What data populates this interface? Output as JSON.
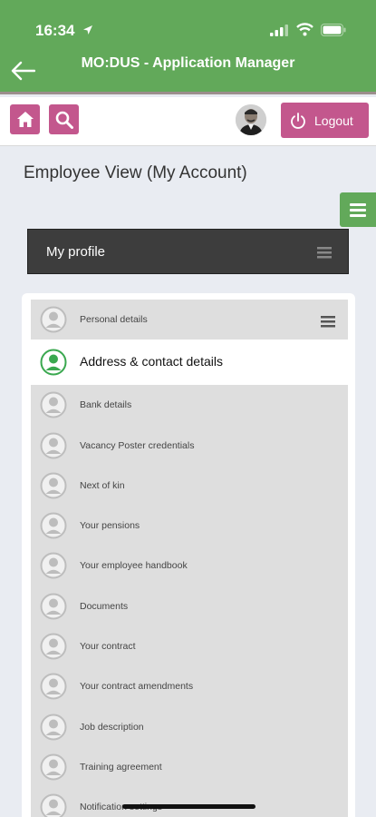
{
  "status": {
    "time": "16:34"
  },
  "app": {
    "title": "MO:DUS - Application Manager"
  },
  "toolbar": {
    "logout_label": "Logout"
  },
  "page": {
    "title": "Employee View (My Account)"
  },
  "profile": {
    "title": "My profile"
  },
  "sections": [
    {
      "label": "Personal details"
    },
    {
      "label": "Address & contact details",
      "active": true
    },
    {
      "label": "Bank details"
    },
    {
      "label": "Vacancy Poster credentials"
    },
    {
      "label": "Next of kin"
    },
    {
      "label": "Your pensions"
    },
    {
      "label": "Your employee handbook"
    },
    {
      "label": "Documents"
    },
    {
      "label": "Your contract"
    },
    {
      "label": "Your contract amendments"
    },
    {
      "label": "Job description"
    },
    {
      "label": "Training agreement"
    },
    {
      "label": "Notification settings"
    }
  ],
  "colors": {
    "brand_green": "#62a95a",
    "accent_pink": "#c3578d",
    "active_icon": "#3aa84f"
  }
}
